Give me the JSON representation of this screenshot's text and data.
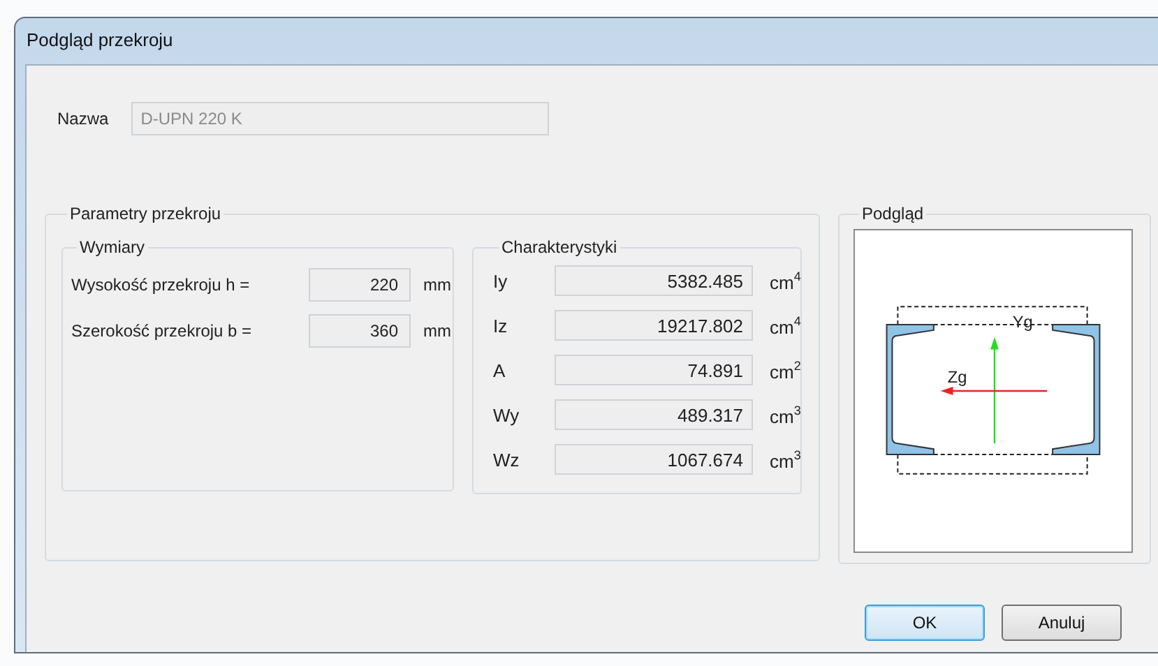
{
  "window": {
    "title": "Podgląd przekroju"
  },
  "name_field": {
    "label": "Nazwa",
    "value": "D-UPN 220 K",
    "disabled": true
  },
  "parameters": {
    "title": "Parametry przekroju",
    "dimensions": {
      "title": "Wymiary",
      "rows": [
        {
          "label": "Wysokość przekroju h =",
          "value": "220",
          "unit": "mm"
        },
        {
          "label": "Szerokość przekroju b =",
          "value": "360",
          "unit": "mm"
        }
      ]
    },
    "characteristics": {
      "title": "Charakterystyki",
      "rows": [
        {
          "label": "Iy",
          "value": "5382.485",
          "unit": "cm$^{4}$"
        },
        {
          "label": "Iz",
          "value": "19217.802",
          "unit": "cm$^{4}$"
        },
        {
          "label": "A",
          "value": "74.891",
          "unit": "cm$^{2}$"
        },
        {
          "label": "Wy",
          "value": "489.317",
          "unit": "cm$^{3}$"
        },
        {
          "label": "Wz",
          "value": "1067.674",
          "unit": "cm$^{3}$"
        }
      ]
    }
  },
  "preview": {
    "title": "Podgląd",
    "y_axis_label": "Yg",
    "z_axis_label": "Zg"
  },
  "buttons": [
    {
      "label": "OK",
      "default": true
    },
    {
      "label": "Anuluj",
      "default": false
    }
  ]
}
